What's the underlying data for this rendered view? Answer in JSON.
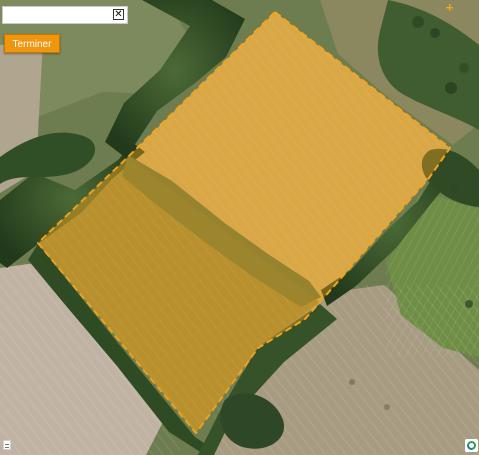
{
  "panel": {
    "close_label": "✕"
  },
  "finish_button": {
    "label": "Terminer"
  },
  "map": {
    "polygon_fill": "#f0a31f",
    "polygon_stroke": "#f4a41d",
    "field_fill_upper": "#c6a45a",
    "field_fill_lower": "#9a893f",
    "tree_green": "#304c25",
    "meadow_green": "#6f8450",
    "light_field": "#b8ad96"
  },
  "icons": {
    "close": "close-icon",
    "attribution_left": "provider-logo-icon",
    "attribution_right": "geoportail-logo-icon",
    "vertex": "vertex-handle-icon"
  }
}
